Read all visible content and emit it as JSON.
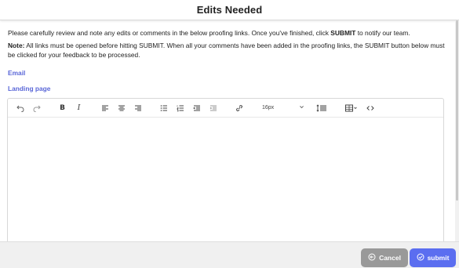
{
  "header": {
    "title": "Edits Needed"
  },
  "content": {
    "intro_part1": "Please carefully review and note any edits or comments in the below proofing links. Once you've finished, click ",
    "intro_bold": "SUBMIT",
    "intro_part2": " to notify our team.",
    "note_label": "Note:",
    "note_text": " All links must be opened before hitting SUBMIT. When all your comments have been added in the proofing links, the SUBMIT button below must be clicked for your feedback to be processed."
  },
  "links": [
    {
      "label": "Email"
    },
    {
      "label": "Landing page"
    }
  ],
  "toolbar": {
    "font_size": "16px"
  },
  "footer": {
    "cancel_label": "Cancel",
    "submit_label": "submit"
  },
  "colors": {
    "link": "#5a67d8",
    "submit": "#5b6ef0",
    "cancel": "#999999"
  }
}
